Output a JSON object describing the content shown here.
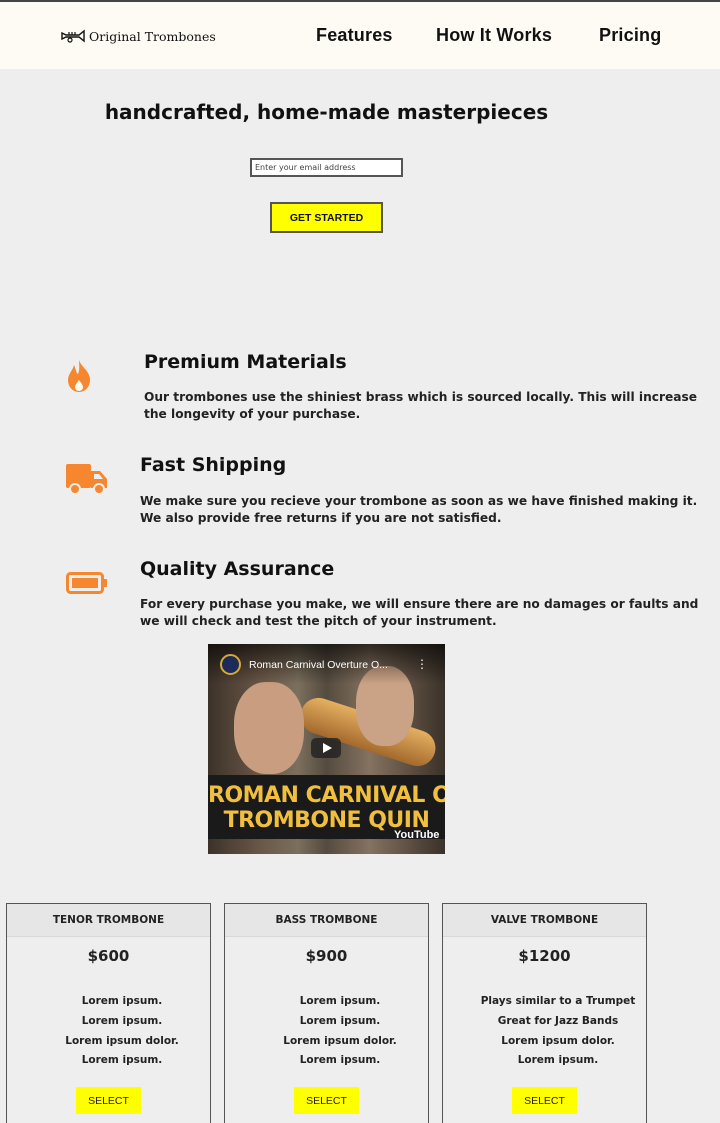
{
  "header": {
    "logo_text": "Original Trombones",
    "nav": [
      {
        "label": "Features"
      },
      {
        "label": "How It Works"
      },
      {
        "label": "Pricing"
      }
    ]
  },
  "hero": {
    "heading": "handcrafted, home-made masterpieces",
    "email_placeholder": "Enter your email address",
    "cta_label": "GET STARTED"
  },
  "features": [
    {
      "icon": "fire-icon",
      "title": "Premium Materials",
      "text": "Our trombones use the shiniest brass which is sourced locally. This will increase the longevity of your purchase."
    },
    {
      "icon": "truck-icon",
      "title": "Fast Shipping",
      "text": "We make sure you recieve your trombone as soon as we have finished making it. We also provide free returns if you are not satisfied."
    },
    {
      "icon": "battery-icon",
      "title": "Quality Assurance",
      "text": "For every purchase you make, we will ensure there are no damages or faults and we will check and test the pitch of your instrument."
    }
  ],
  "video": {
    "title": "Roman Carnival Overture O...",
    "overlay_line1": "ROMAN CARNIVAL OVER",
    "overlay_line2": "TROMBONE QUIN",
    "brand": "YouTube"
  },
  "pricing": [
    {
      "name": "TENOR TROMBONE",
      "price": "$600",
      "features": [
        "Lorem ipsum.",
        "Lorem ipsum.",
        "Lorem ipsum dolor.",
        "Lorem ipsum."
      ],
      "button": "SELECT"
    },
    {
      "name": "BASS TROMBONE",
      "price": "$900",
      "features": [
        "Lorem ipsum.",
        "Lorem ipsum.",
        "Lorem ipsum dolor.",
        "Lorem ipsum."
      ],
      "button": "SELECT"
    },
    {
      "name": "VALVE TROMBONE",
      "price": "$1200",
      "features": [
        "Plays similar to a Trumpet",
        "Great for Jazz Bands",
        "Lorem ipsum dolor.",
        "Lorem ipsum."
      ],
      "button": "SELECT"
    }
  ],
  "colors": {
    "accent_yellow": "#ffff00",
    "icon_orange": "#f6872e",
    "background": "#eeeeee",
    "header_bg": "#fdfbf4"
  }
}
